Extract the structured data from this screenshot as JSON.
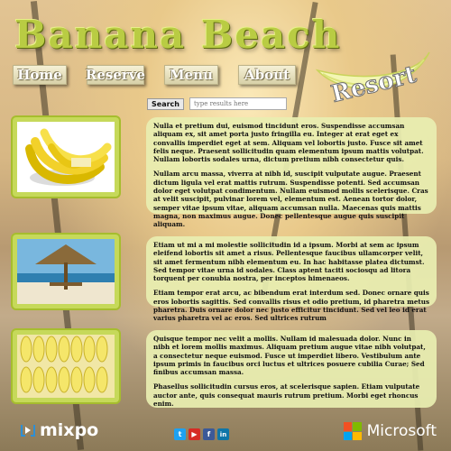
{
  "site": {
    "title": "Banana Beach",
    "logo_text": "Resort"
  },
  "nav": [
    {
      "label": "Home"
    },
    {
      "label": "Reserve"
    },
    {
      "label": "Menu"
    },
    {
      "label": "About"
    }
  ],
  "search": {
    "button_label": "Search",
    "placeholder": "type results here"
  },
  "sections": [
    {
      "image_icon": "bananas-bunch-image",
      "paragraphs": [
        "Nulla et pretium dui, euismod tincidunt eros. Suspendisse accumsan aliquam ex, sit amet porta justo fringilla eu. Integer at erat eget ex convallis imperdiet eget at sem. Aliquam vel lobortis justo. Fusce sit amet felis neque. Praesent sollicitudin quam elementum ipsum mattis volutpat. Nullam lobortis sodales urna, dictum pretium nibh consectetur quis.",
        "Nullam arcu massa, viverra at nibh id, suscipit vulputate augue. Praesent dictum ligula vel erat mattis rutrum. Suspendisse potenti. Sed accumsan dolor eget volutpat condimentum. Nullam euismod mollis scelerisque. Cras at velit suscipit, pulvinar lorem vel, elementum est. Aenean tortor dolor, semper vitae ipsum vitae, aliquam accumsan nulla. Maecenas quis mattis magna, non maximus augue. Donec pellentesque augue quis suscipit aliquam."
      ]
    },
    {
      "image_icon": "beach-hut-image",
      "paragraphs": [
        "Etiam ut mi a mi molestie sollicitudin id a ipsum. Morbi at sem ac ipsum eleifend lobortis sit amet a risus. Pellentesque faucibus ullamcorper velit, sit amet fermentum nibh elementum eu. In hac habitasse platea dictumst. Sed tempor vitae urna id sodales. Class aptent taciti sociosqu ad litora torquent per conubia nostra, per inceptos himenaeos.",
        "Etiam tempor erat arcu, ac bibendum erat interdum sed. Donec ornare quis eros lobortis sagittis. Sed convallis risus et odio pretium, id pharetra metus pharetra. Duis ornare dolor nec justo efficitur tincidunt. Sed vel leo id erat varius pharetra vel ac eros. Sed ultrices rutrum"
      ]
    },
    {
      "image_icon": "banana-rows-image",
      "paragraphs": [
        "Quisque tempor nec velit a mollis. Nullam id malesuada dolor. Nunc in nibh et lorem mollis maximus. Aliquam pretium augue vitae nibh volutpat, a consectetur neque euismod. Fusce ut imperdiet libero. Vestibulum ante ipsum primis in faucibus orci luctus et ultrices posuere cubilia Curae; Sed finibus accumsan massa.",
        "Phasellus sollicitudin cursus eros, at scelerisque sapien. Etiam vulputate auctor ante, quis consequat mauris rutrum pretium. Morbi eget rhoncus enim."
      ]
    }
  ],
  "footer": {
    "brand_left": "mixpo",
    "brand_right": "Microsoft",
    "social": [
      {
        "icon": "twitter-icon",
        "glyph": "t",
        "color": "#1da1f2"
      },
      {
        "icon": "youtube-icon",
        "glyph": "▶",
        "color": "#d62b24"
      },
      {
        "icon": "facebook-icon",
        "glyph": "f",
        "color": "#3b5998"
      },
      {
        "icon": "linkedin-icon",
        "glyph": "in",
        "color": "#0e76a8"
      }
    ]
  },
  "colors": {
    "title_green": "#b9cc43",
    "card_bg": "#e8eeb0",
    "image_frame": "#c6d95a"
  }
}
